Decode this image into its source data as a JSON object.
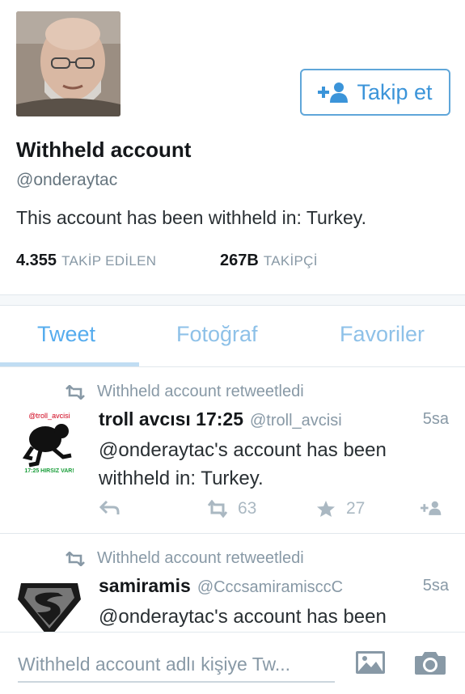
{
  "profile": {
    "display_name": "Withheld account",
    "handle": "@onderaytac",
    "bio": "This account has been withheld in: Turkey.",
    "follow_label": "Takip et",
    "following_count": "4.355",
    "following_label": "TAKİP EDİLEN",
    "followers_count": "267B",
    "followers_label": "TAKİPÇİ"
  },
  "tabs": [
    {
      "label": "Tweet",
      "active": true
    },
    {
      "label": "Fotoğraf",
      "active": false
    },
    {
      "label": "Favoriler",
      "active": false
    }
  ],
  "tweets": [
    {
      "retweet_context": "Withheld account retweetledi",
      "avatar_text_top": "@troll_avcisi",
      "avatar_text_bottom": "17:25 HIRSIZ VAR!",
      "name": "troll avcısı 17:25",
      "handle": "@troll_avcisi",
      "time": "5sa",
      "body": "@onderaytac's account has been withheld in: Turkey.",
      "retweets": "63",
      "favorites": "27"
    },
    {
      "retweet_context": "Withheld account retweetledi",
      "name": "samiramis",
      "handle": "@CccsamiramisccC",
      "time": "5sa",
      "body": "@onderaytac's account has been"
    }
  ],
  "compose": {
    "placeholder": "Withheld account adlı kişiye Tw..."
  },
  "icons": {
    "follow": "add-user-icon",
    "retweet": "retweet-icon",
    "reply": "reply-icon",
    "favorite": "star-icon",
    "photo": "photo-icon",
    "camera": "camera-icon"
  },
  "colors": {
    "accent": "#55acee",
    "muted": "#8899a6",
    "text": "#292f33"
  }
}
